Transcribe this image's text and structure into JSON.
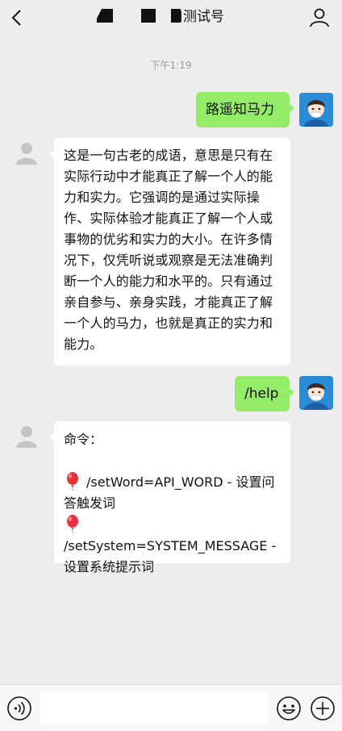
{
  "header": {
    "title": "口测试号",
    "back_icon": "chevron-left-icon",
    "profile_icon": "person-icon"
  },
  "timestamp": "下午1:19",
  "messages": [
    {
      "sender": "me",
      "text": "路遥知马力"
    },
    {
      "sender": "bot",
      "text": "这是一句古老的成语，意思是只有在实际行动中才能真正了解一个人的能力和实力。它强调的是通过实际操作、实际体验才能真正了解一个人或事物的优劣和实力的大小。在许多情况下，仅凭听说或观察是无法准确判断一个人的能力和水平的。只有通过亲自参与、亲身实践，才能真正了解一个人的马力，也就是真正的实力和能力。"
    },
    {
      "sender": "me",
      "text": "/help"
    },
    {
      "sender": "bot",
      "header": "命令：",
      "commands": [
        {
          "icon": "balloon-icon",
          "text": "/setWord=API_WORD - 设置问答触发词"
        },
        {
          "icon": "balloon-icon",
          "text": "/setSystem=SYSTEM_MESSAGE - 设置系统提示词"
        }
      ]
    }
  ],
  "bottom_bar": {
    "input_value": "",
    "voice_icon": "voice-icon",
    "emoji_icon": "emoji-icon",
    "plus_icon": "plus-icon"
  },
  "colors": {
    "background": "#ededed",
    "my_bubble": "#95ec69",
    "bot_bubble": "#ffffff",
    "avatar_blue": "#2a8bd6"
  }
}
